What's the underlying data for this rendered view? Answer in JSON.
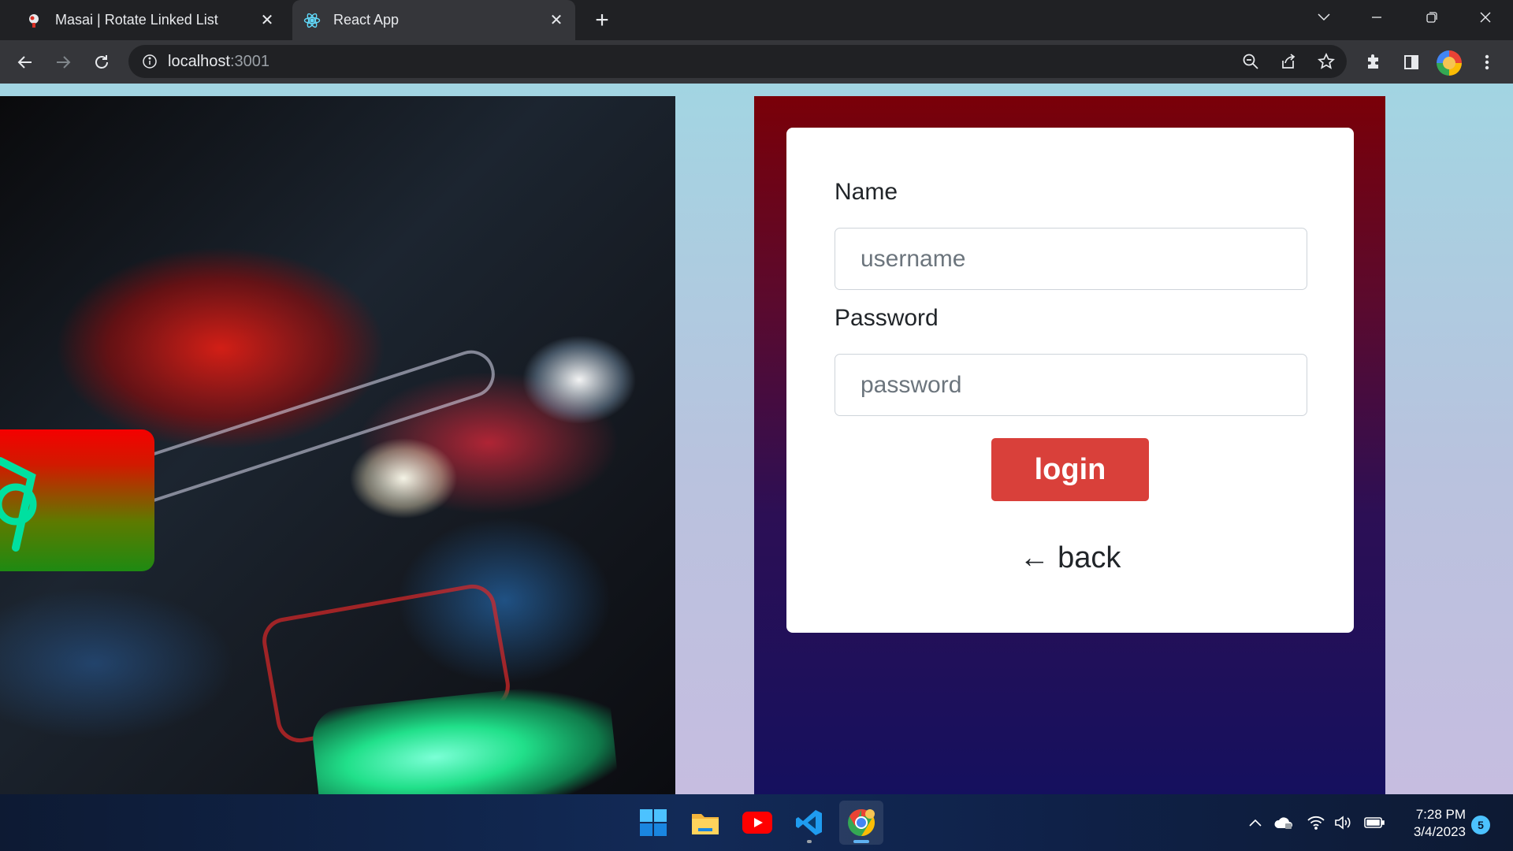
{
  "browser": {
    "tabs": [
      {
        "title": "Masai | Rotate Linked List",
        "active": false
      },
      {
        "title": "React App",
        "active": true
      }
    ],
    "url": {
      "host": "localhost",
      "port": ":3001"
    }
  },
  "form": {
    "name_label": "Name",
    "name_placeholder": "username",
    "password_label": "Password",
    "password_placeholder": "password",
    "login_label": "login",
    "back_label": "← back"
  },
  "taskbar": {
    "apps": [
      "windows-start",
      "file-explorer",
      "youtube",
      "vs-code",
      "chrome"
    ],
    "time": "7:28 PM",
    "date": "3/4/2023",
    "notification_count": "5"
  },
  "colors": {
    "login_button": "#d9403a",
    "panel_top": "#7a0008",
    "panel_bottom": "#15105e",
    "page_bg_top": "#a2d5e2",
    "page_bg_bottom": "#c6bde0"
  }
}
